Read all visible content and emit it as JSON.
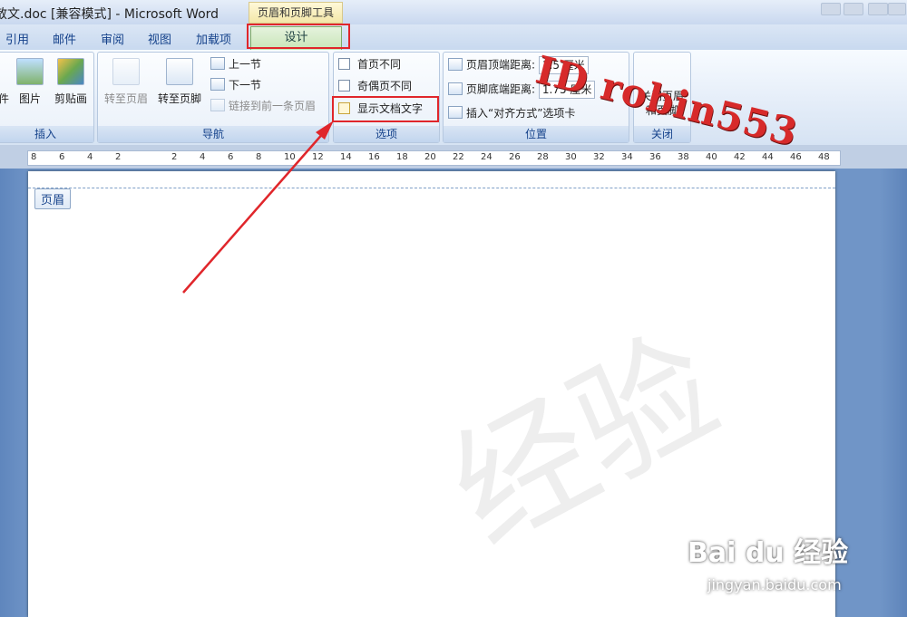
{
  "window": {
    "title": "散文.doc [兼容模式] - Microsoft Word",
    "contextual_tools_label": "页眉和页脚工具"
  },
  "tabs": [
    "引用",
    "邮件",
    "审阅",
    "视图",
    "加载项"
  ],
  "active_tab": "设计",
  "ribbon": {
    "insert_group": {
      "label": "插入",
      "partial_label": "件",
      "picture_label": "图片",
      "clipart_label": "剪贴画"
    },
    "nav_group": {
      "label": "导航",
      "goto_header": "转至页眉",
      "goto_footer": "转至页脚",
      "prev_section": "上一节",
      "next_section": "下一节",
      "link_prev": "链接到前一条页眉"
    },
    "options_group": {
      "label": "选项",
      "diff_first_page": "首页不同",
      "diff_odd_even": "奇偶页不同",
      "show_doc_text": "显示文档文字"
    },
    "position_group": {
      "label": "位置",
      "header_top": "页眉顶端距离:",
      "header_top_value": "1.5 厘米",
      "footer_bottom": "页脚底端距离:",
      "footer_bottom_value": "1.75 厘米",
      "insert_align_tab": "插入“对齐方式”选项卡"
    },
    "close_group": {
      "label": "关闭",
      "close_button": "关闭页眉和页脚"
    }
  },
  "ruler": {
    "ticks": [
      "8",
      "6",
      "4",
      "2",
      "",
      "2",
      "4",
      "6",
      "8",
      "10",
      "12",
      "14",
      "16",
      "18",
      "20",
      "22",
      "24",
      "26",
      "28",
      "30",
      "32",
      "34",
      "36",
      "38",
      "40",
      "42",
      "44",
      "46",
      "48"
    ]
  },
  "document": {
    "header_tag": "页眉",
    "background_watermark": "经验"
  },
  "overlays": {
    "author_id": "ID robin553",
    "baidu_logo": "Bai du 经验",
    "baidu_url": "jingyan.baidu.com"
  },
  "colors": {
    "highlight_red": "#e0262b",
    "active_tab_green": "#c7e4b6",
    "ribbon_text": "#15428b"
  }
}
